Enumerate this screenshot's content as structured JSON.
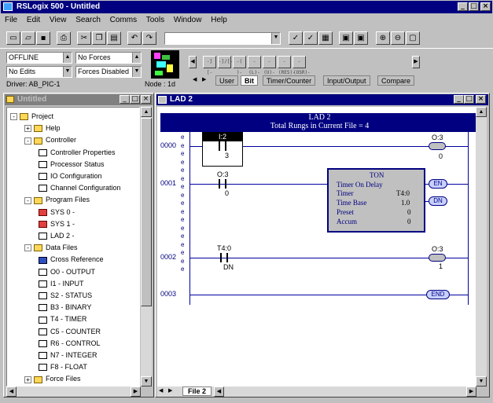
{
  "app": {
    "title": "RSLogix 500 - Untitled"
  },
  "menu": [
    "File",
    "Edit",
    "View",
    "Search",
    "Comms",
    "Tools",
    "Window",
    "Help"
  ],
  "combos": {
    "mode": "OFFLINE",
    "forces": "No Forces",
    "edits": "No Edits",
    "forces_state": "Forces Disabled",
    "toolbar_combo": ""
  },
  "status": {
    "driver": "Driver: AB_PIC-1",
    "node": "Node : 1d"
  },
  "instr_buttons": [
    "-] [-",
    "-]/[-",
    "-( )-",
    "-(L)-",
    "-(U)-",
    "-(RES)-",
    "-(OSR)-"
  ],
  "instr_tabs": [
    "User",
    "Bit",
    "Timer/Counter",
    "Input/Output",
    "Compare"
  ],
  "project_window": {
    "title": "Untitled"
  },
  "tree": [
    {
      "label": "Project",
      "icon": "folder",
      "exp": "-"
    },
    {
      "label": "Help",
      "icon": "folder",
      "exp": "+"
    },
    {
      "label": "Controller",
      "icon": "folder",
      "exp": "-"
    },
    {
      "label": "Controller Properties",
      "icon": "info"
    },
    {
      "label": "Processor Status",
      "icon": "doc"
    },
    {
      "label": "IO Configuration",
      "icon": "doc"
    },
    {
      "label": "Channel Configuration",
      "icon": "doc"
    },
    {
      "label": "Program Files",
      "icon": "folder",
      "exp": "-"
    },
    {
      "label": "SYS 0 -",
      "icon": "red"
    },
    {
      "label": "SYS 1 -",
      "icon": "red"
    },
    {
      "label": "LAD 2 -",
      "icon": "doc"
    },
    {
      "label": "Data Files",
      "icon": "folder",
      "exp": "-"
    },
    {
      "label": "Cross Reference",
      "icon": "blue"
    },
    {
      "label": "O0 - OUTPUT",
      "icon": "doc"
    },
    {
      "label": "I1 - INPUT",
      "icon": "doc"
    },
    {
      "label": "S2 - STATUS",
      "icon": "doc"
    },
    {
      "label": "B3 - BINARY",
      "icon": "doc"
    },
    {
      "label": "T4 - TIMER",
      "icon": "doc"
    },
    {
      "label": "C5 - COUNTER",
      "icon": "doc"
    },
    {
      "label": "R6 - CONTROL",
      "icon": "doc"
    },
    {
      "label": "N7 - INTEGER",
      "icon": "doc"
    },
    {
      "label": "F8 - FLOAT",
      "icon": "doc"
    },
    {
      "label": "Force Files",
      "icon": "folder",
      "exp": "+"
    }
  ],
  "ladder_window": {
    "title": "LAD 2",
    "header": "LAD 2",
    "subheader": "Total Rungs in Current File = 4",
    "file_tab": "File 2"
  },
  "rungs": {
    "r0": {
      "num": "0000",
      "contact_addr": "I:2",
      "contact_bit": "3",
      "coil_addr": "O:3",
      "coil_bit": "0"
    },
    "r1": {
      "num": "0001",
      "contact_addr": "O:3",
      "contact_bit": "0",
      "ton_title": "TON",
      "ton_name": "Timer On Delay",
      "timer_label": "Timer",
      "timer_val": "T4:0",
      "base_label": "Time Base",
      "base_val": "1.0",
      "preset_label": "Preset",
      "preset_val": "0",
      "accum_label": "Accum",
      "accum_val": "0",
      "en": "EN",
      "dn": "DN"
    },
    "r2": {
      "num": "0002",
      "contact_addr": "T4:0",
      "contact_bit": "DN",
      "coil_addr": "O:3",
      "coil_bit": "1"
    },
    "r3": {
      "num": "0003",
      "end": "END"
    }
  }
}
